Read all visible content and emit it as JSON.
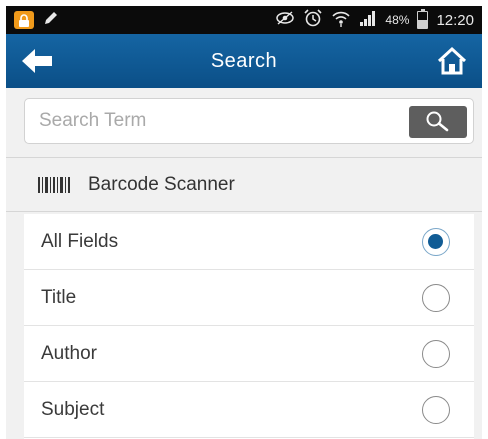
{
  "status_bar": {
    "battery_percent": "48%",
    "battery_level": 0.48,
    "time": "12:20"
  },
  "header": {
    "title": "Search",
    "back_icon": "arrow-left-icon",
    "home_icon": "home-icon"
  },
  "search": {
    "placeholder": "Search Term",
    "value": "",
    "button_icon": "magnifier-icon"
  },
  "barcode": {
    "label": "Barcode Scanner",
    "icon": "barcode-icon"
  },
  "options": [
    {
      "label": "All Fields",
      "selected": true
    },
    {
      "label": "Title",
      "selected": false
    },
    {
      "label": "Author",
      "selected": false
    },
    {
      "label": "Subject",
      "selected": false
    }
  ],
  "colors": {
    "header_top": "#1565a3",
    "header_bottom": "#0b4f87",
    "radio_selected": "#115c95",
    "lock_badge": "#f09a1b"
  }
}
